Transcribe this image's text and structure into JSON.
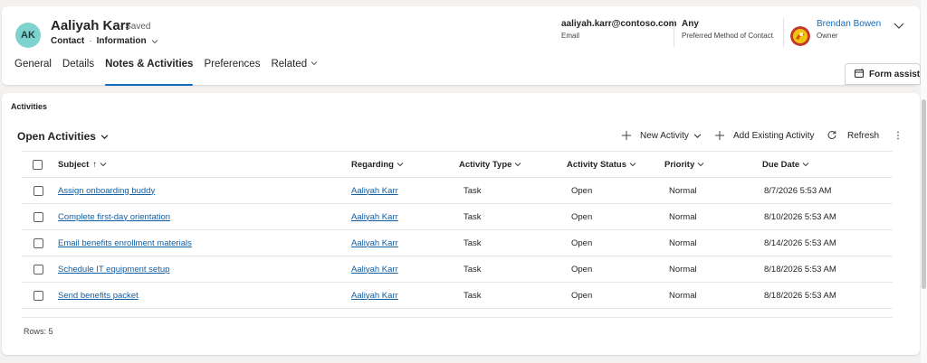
{
  "record": {
    "initials": "AK",
    "name": "Aaliyah Karr",
    "saved_status": "- Saved",
    "entity_type": "Contact",
    "separator": "·",
    "form_name": "Information"
  },
  "header_fields": [
    {
      "value": "aaliyah.karr@contoso.com",
      "label": "Email"
    },
    {
      "value": "Any",
      "label": "Preferred Method of Contact"
    }
  ],
  "owner": {
    "name": "Brendan Bowen",
    "label": "Owner"
  },
  "tabs": [
    {
      "label": "General"
    },
    {
      "label": "Details"
    },
    {
      "label": "Notes & Activities",
      "active": true
    },
    {
      "label": "Preferences"
    },
    {
      "label": "Related"
    }
  ],
  "form_assist": {
    "label": "Form assist"
  },
  "activities": {
    "section_title": "Activities",
    "view_name": "Open Activities",
    "commands": {
      "new_activity": "New Activity",
      "add_existing": "Add Existing Activity",
      "refresh": "Refresh"
    },
    "columns": [
      "Subject",
      "Regarding",
      "Activity Type",
      "Activity Status",
      "Priority",
      "Due Date"
    ],
    "sort_indicator": "↑",
    "rows": [
      {
        "subject": "Assign onboarding buddy",
        "regarding": "Aaliyah Karr",
        "type": "Task",
        "status": "Open",
        "priority": "Normal",
        "due": "8/7/2026 5:53 AM"
      },
      {
        "subject": "Complete first-day orientation",
        "regarding": "Aaliyah Karr",
        "type": "Task",
        "status": "Open",
        "priority": "Normal",
        "due": "8/10/2026 5:53 AM"
      },
      {
        "subject": "Email benefits enrollment materials",
        "regarding": "Aaliyah Karr",
        "type": "Task",
        "status": "Open",
        "priority": "Normal",
        "due": "8/14/2026 5:53 AM"
      },
      {
        "subject": "Schedule IT equipment setup",
        "regarding": "Aaliyah Karr",
        "type": "Task",
        "status": "Open",
        "priority": "Normal",
        "due": "8/18/2026 5:53 AM"
      },
      {
        "subject": "Send benefits packet",
        "regarding": "Aaliyah Karr",
        "type": "Task",
        "status": "Open",
        "priority": "Normal",
        "due": "8/18/2026 5:53 AM"
      }
    ],
    "rows_count": "Rows: 5"
  },
  "colors": {
    "accent": "#0f6cbd",
    "link": "#115ea3",
    "avatar_bg": "#7fd3cf"
  }
}
